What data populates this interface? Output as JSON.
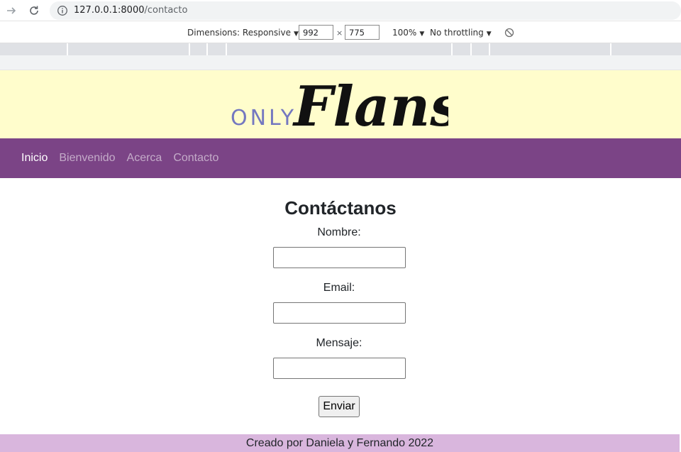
{
  "browser": {
    "url_host": "127.0.0.1:8000",
    "url_path": "/contacto"
  },
  "devtools": {
    "dimensions_label": "Dimensions: Responsive",
    "width_value": "992",
    "height_value": "775",
    "times_symbol": "×",
    "zoom_label": "100%",
    "throttling_label": "No throttling",
    "caret": "▼"
  },
  "logo": {
    "prefix": "ONLY",
    "script": "Flans",
    "prefix_color": "#7478c0",
    "script_color": "#111111"
  },
  "nav": {
    "items": [
      {
        "label": "Inicio",
        "active": true
      },
      {
        "label": "Bienvenido",
        "active": false
      },
      {
        "label": "Acerca",
        "active": false
      },
      {
        "label": "Contacto",
        "active": false
      }
    ]
  },
  "form": {
    "title": "Contáctanos",
    "name_label": "Nombre:",
    "name_value": "",
    "email_label": "Email:",
    "email_value": "",
    "message_label": "Mensaje:",
    "message_value": "",
    "submit_label": "Enviar"
  },
  "footer": {
    "text": "Creado por Daniela y Fernando 2022"
  },
  "colors": {
    "hero_bg": "#fffdcc",
    "navbar_bg": "#7b4486",
    "footer_bg": "#d9b6dd"
  }
}
